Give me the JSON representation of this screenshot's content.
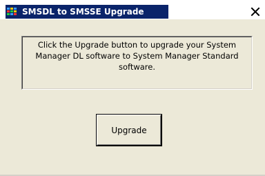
{
  "window": {
    "title": "SMSDL to SMSSE Upgrade",
    "icon": "app-grid-icon",
    "close_glyph": "✕"
  },
  "message": {
    "text": "Click the Upgrade button to upgrade your System Manager DL software to System Manager Standard software."
  },
  "actions": {
    "upgrade_label": "Upgrade"
  },
  "colors": {
    "title_active": "#0a246a",
    "dialog_face": "#ece9d8"
  }
}
